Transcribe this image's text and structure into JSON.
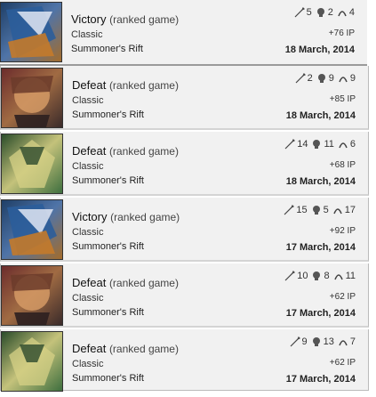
{
  "match_history": [
    {
      "outcome": "Victory",
      "queue": "(ranked game)",
      "mode": "Classic",
      "map": "Summoner's Rift",
      "kills": "5",
      "deaths": "2",
      "assists": "4",
      "ip": "+76 IP",
      "date": "18 March, 2014",
      "portrait": "victory-portrait-a"
    },
    {
      "outcome": "Defeat",
      "queue": "(ranked game)",
      "mode": "Classic",
      "map": "Summoner's Rift",
      "kills": "2",
      "deaths": "9",
      "assists": "9",
      "ip": "+85 IP",
      "date": "18 March, 2014",
      "portrait": "defeat-portrait-b"
    },
    {
      "outcome": "Defeat",
      "queue": "(ranked game)",
      "mode": "Classic",
      "map": "Summoner's Rift",
      "kills": "14",
      "deaths": "11",
      "assists": "6",
      "ip": "+68 IP",
      "date": "18 March, 2014",
      "portrait": "defeat-portrait-c"
    },
    {
      "outcome": "Victory",
      "queue": "(ranked game)",
      "mode": "Classic",
      "map": "Summoner's Rift",
      "kills": "15",
      "deaths": "5",
      "assists": "17",
      "ip": "+92 IP",
      "date": "17 March, 2014",
      "portrait": "victory-portrait-a"
    },
    {
      "outcome": "Defeat",
      "queue": "(ranked game)",
      "mode": "Classic",
      "map": "Summoner's Rift",
      "kills": "10",
      "deaths": "8",
      "assists": "11",
      "ip": "+62 IP",
      "date": "17 March, 2014",
      "portrait": "defeat-portrait-b"
    },
    {
      "outcome": "Defeat",
      "queue": "(ranked game)",
      "mode": "Classic",
      "map": "Summoner's Rift",
      "kills": "9",
      "deaths": "13",
      "assists": "7",
      "ip": "+62 IP",
      "date": "17 March, 2014",
      "portrait": "defeat-portrait-c"
    }
  ],
  "icons": {
    "kills": "sword-icon",
    "deaths": "skull-icon",
    "assists": "assist-icon"
  },
  "colors": {
    "row_bg": "#f1f1f1",
    "divider": "#d4d4d4",
    "text": "#222222"
  }
}
